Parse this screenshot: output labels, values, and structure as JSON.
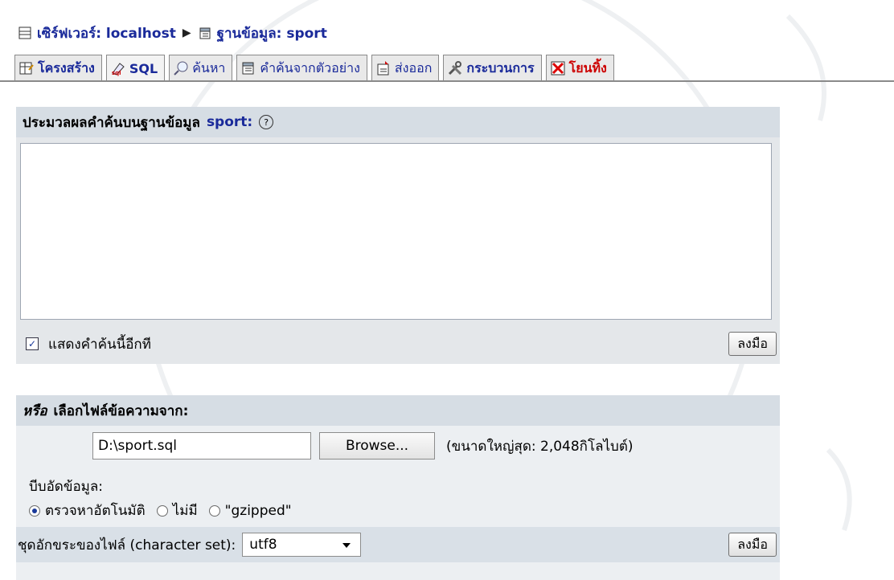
{
  "breadcrumb": {
    "server_label": "เซิร์ฟเวอร์: localhost",
    "separator": "▶",
    "db_label": "ฐานข้อมูล: sport"
  },
  "tabs": [
    {
      "label": "โครงสร้าง",
      "icon": "structure-icon"
    },
    {
      "label": "SQL",
      "icon": "sql-icon"
    },
    {
      "label": "ค้นหา",
      "icon": "search-icon"
    },
    {
      "label": "คำค้นจากตัวอย่าง",
      "icon": "query-icon"
    },
    {
      "label": "ส่งออก",
      "icon": "export-icon"
    },
    {
      "label": "กระบวนการ",
      "icon": "operations-icon"
    },
    {
      "label": "โยนทิ้ง",
      "icon": "drop-icon"
    }
  ],
  "sql_panel": {
    "title": "ประมวลผลคำค้นบนฐานข้อมูล",
    "db_name": "sport:",
    "help_glyph": "?",
    "textarea_value": "",
    "show_again_label": "แสดงคำค้นนี้อีกที",
    "show_again_checked": true,
    "go_label": "ลงมือ"
  },
  "file_panel": {
    "title_em": "หรือ",
    "title": "เลือกไฟล์ข้อความจาก:",
    "file_value": "D:\\sport.sql",
    "browse_label": "Browse...",
    "max_size": "(ขนาดใหญ่สุด: 2,048กิโลไบต์)",
    "compression_label": "บีบอัดข้อมูล:",
    "compression_options": [
      {
        "label": "ตรวจหาอัตโนมัติ",
        "selected": true
      },
      {
        "label": "ไม่มี",
        "selected": false
      },
      {
        "label": "\"gzipped\"",
        "selected": false
      }
    ],
    "charset_label": "ชุดอักขระของไฟล์ (character set):",
    "charset_value": "utf8",
    "go_label": "ลงมือ"
  },
  "colors": {
    "link": "#1a2a9a",
    "danger": "#cc0000",
    "panel_header": "#d6dde4",
    "panel_bg": "#e4e7ea"
  }
}
